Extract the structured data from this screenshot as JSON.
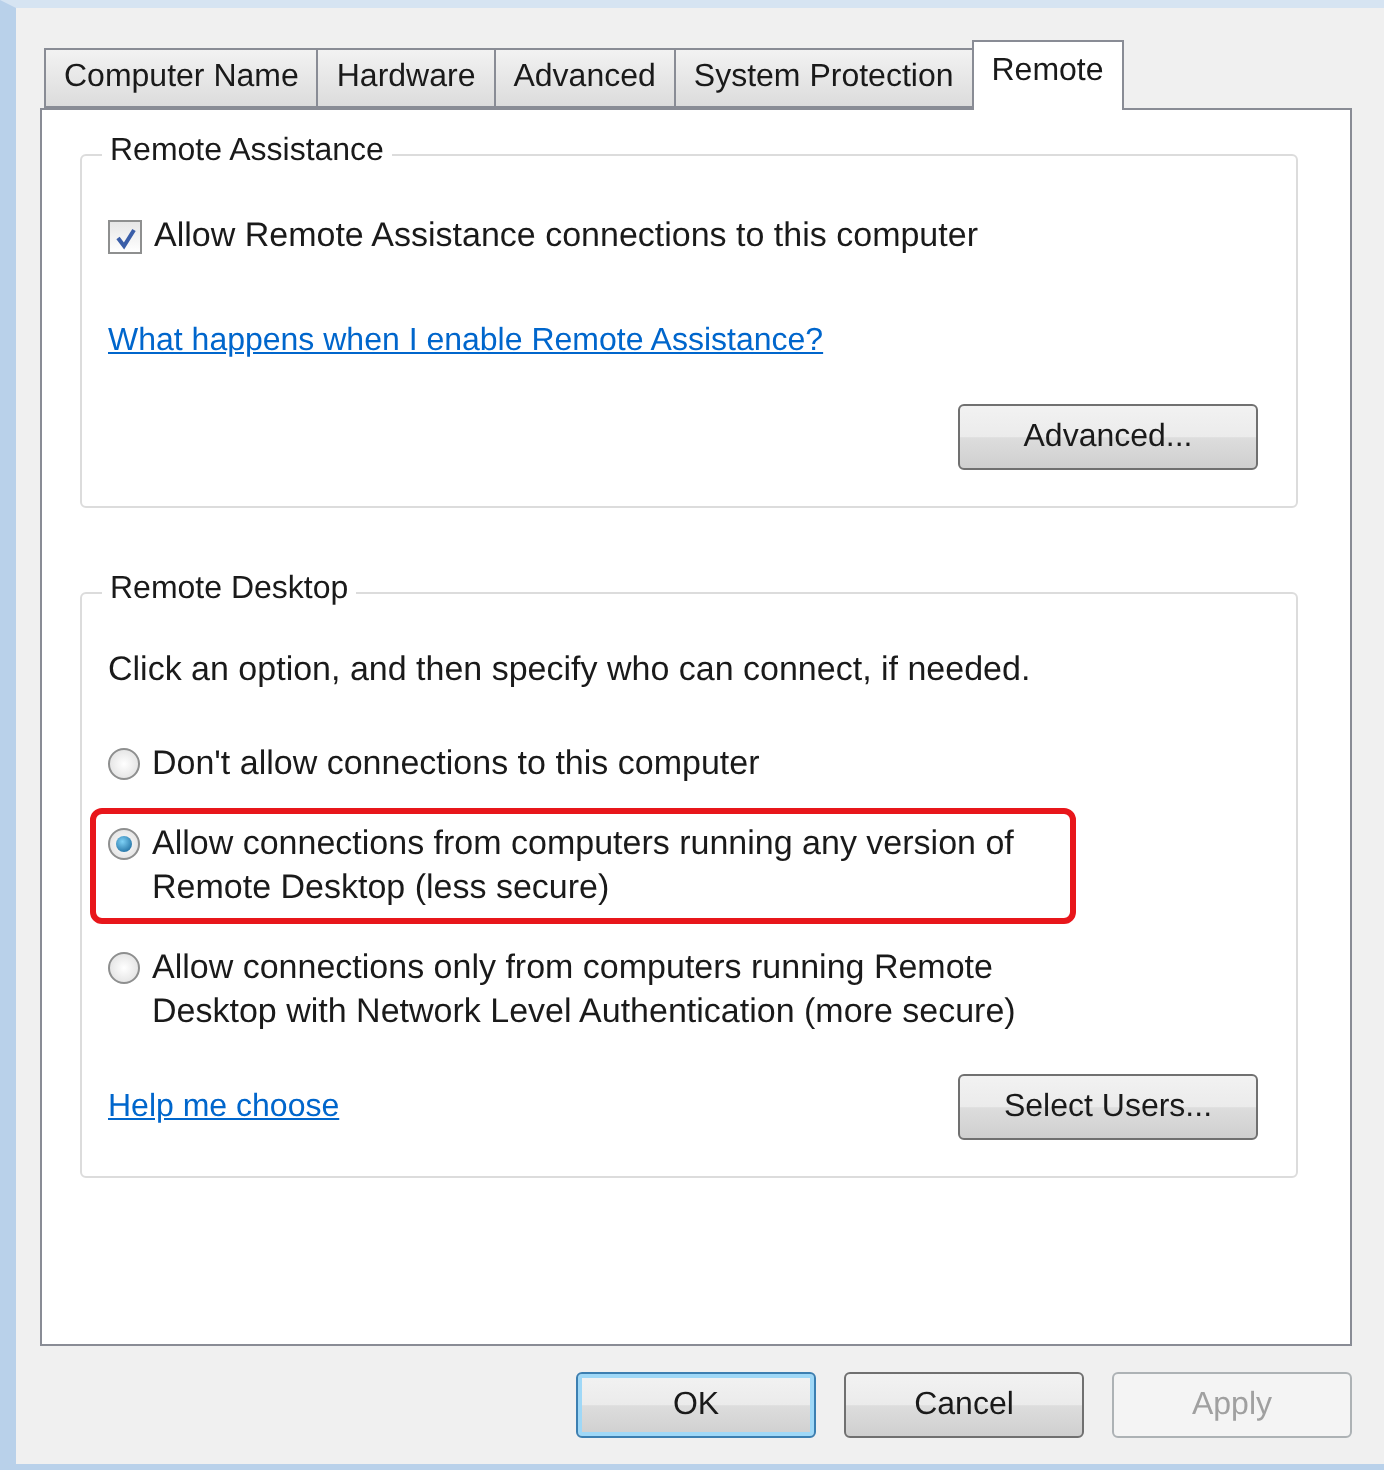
{
  "tabs": [
    {
      "label": "Computer Name",
      "selected": false
    },
    {
      "label": "Hardware",
      "selected": false
    },
    {
      "label": "Advanced",
      "selected": false
    },
    {
      "label": "System Protection",
      "selected": false
    },
    {
      "label": "Remote",
      "selected": true
    }
  ],
  "remote_assistance": {
    "title": "Remote Assistance",
    "checkbox": {
      "label": "Allow Remote Assistance connections to this computer",
      "checked": true
    },
    "link": "What happens when I enable Remote Assistance?",
    "button": "Advanced..."
  },
  "remote_desktop": {
    "title": "Remote Desktop",
    "instructions": "Click an option, and then specify who can connect, if needed.",
    "options": [
      {
        "lines": [
          "Don't allow connections to this computer"
        ],
        "selected": false,
        "highlighted": false
      },
      {
        "lines": [
          "Allow connections from computers running any version of",
          "Remote Desktop (less secure)"
        ],
        "selected": true,
        "highlighted": true
      },
      {
        "lines": [
          "Allow connections only from computers running Remote",
          "Desktop with Network Level Authentication (more secure)"
        ],
        "selected": false,
        "highlighted": false
      }
    ],
    "link": "Help me choose",
    "button": "Select Users..."
  },
  "buttons": [
    {
      "label": "OK",
      "kind": "default",
      "disabled": false
    },
    {
      "label": "Cancel",
      "kind": "normal",
      "disabled": false
    },
    {
      "label": "Apply",
      "kind": "normal",
      "disabled": true
    }
  ]
}
